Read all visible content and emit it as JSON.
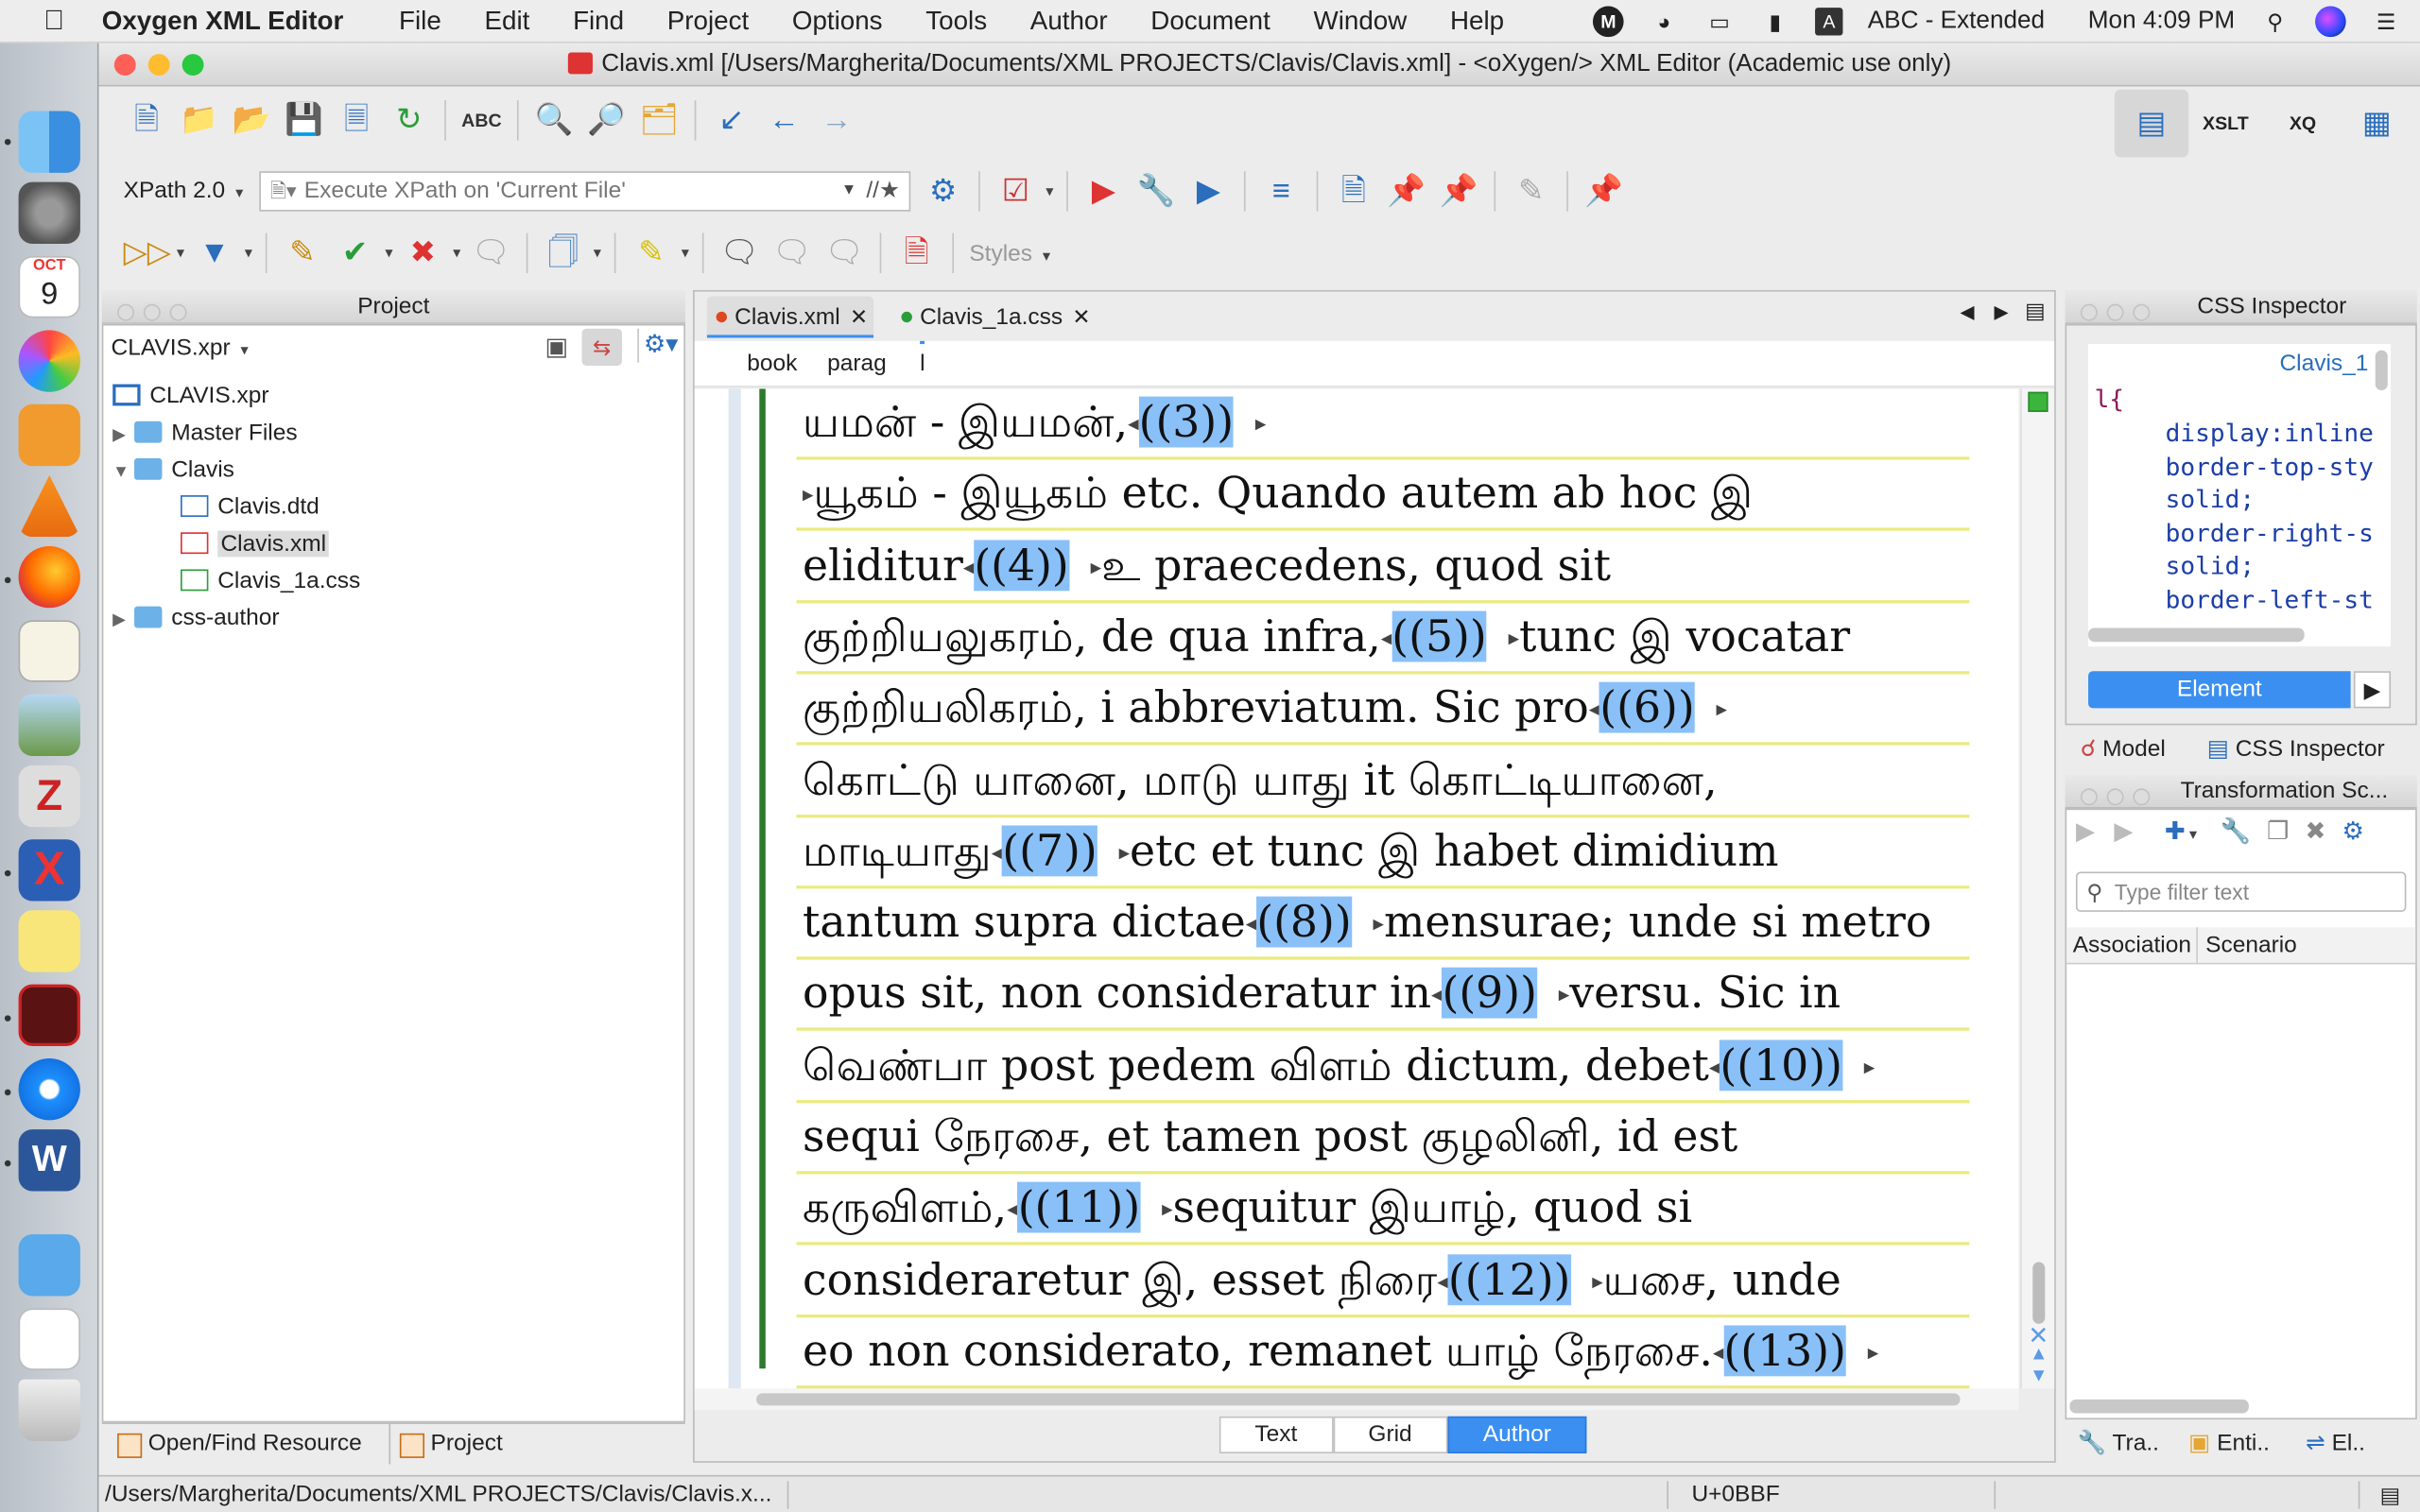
{
  "menubar": {
    "app_name": "Oxygen XML Editor",
    "menus": [
      "File",
      "Edit",
      "Find",
      "Project",
      "Options",
      "Tools",
      "Author",
      "Document",
      "Window",
      "Help"
    ],
    "input_source": "ABC - Extended",
    "clock": "Mon 4:09 PM",
    "m_letter": "M",
    "a_letter": "A"
  },
  "dock": {
    "calendar_month": "OCT",
    "calendar_day": "9"
  },
  "window": {
    "title": "Clavis.xml [/Users/Margherita/Documents/XML PROJECTS/Clavis/Clavis.xml] - <oXygen/> XML Editor (Academic use only)"
  },
  "toolbar": {
    "xpath_version": "XPath 2.0",
    "xpath_placeholder": "Execute XPath on  'Current File'",
    "styles_label": "Styles",
    "xslt_label": "XSLT",
    "xq_label": "XQ",
    "abc_label": "ABC"
  },
  "project": {
    "title": "Project",
    "selector": "CLAVIS.xpr",
    "tree": [
      {
        "label": "CLAVIS.xpr"
      },
      {
        "label": "Master Files"
      },
      {
        "label": "Clavis"
      },
      {
        "label": "Clavis.dtd"
      },
      {
        "label": "Clavis.xml"
      },
      {
        "label": "Clavis_1a.css"
      },
      {
        "label": "css-author"
      }
    ],
    "tabs": [
      "Open/Find Resource",
      "Project"
    ]
  },
  "editor": {
    "tabs": [
      "Clavis.xml",
      "Clavis_1a.css"
    ],
    "breadcrumbs": [
      "book",
      "parag",
      "l"
    ],
    "modes": [
      "Text",
      "Grid",
      "Author"
    ],
    "lines": [
      {
        "pre": "யமன் - இயமன்,",
        "note": "((3))",
        "post": ""
      },
      {
        "pre": "",
        "note": "",
        "post": "யூகம் - இயூகம் etc. Quando autem ab hoc இ"
      },
      {
        "pre": "eliditur",
        "note": "((4))",
        "post": "உ praecedens, quod sit"
      },
      {
        "pre": "குற்றியலுகரம், de qua infra,",
        "note": "((5))",
        "post": "tunc இ vocatar"
      },
      {
        "pre": "குற்றியலிகரம், i abbreviatum. Sic pro",
        "note": "((6))",
        "post": ""
      },
      {
        "pre": "கொட்டு யானை, மாடு யாது it கொட்டியானை,",
        "note": "",
        "post": ""
      },
      {
        "pre": "மாடியாது",
        "note": "((7))",
        "post": "etc et tunc இ habet dimidium"
      },
      {
        "pre": "tantum supra dictae",
        "note": "((8))",
        "post": "mensurae; unde si metro"
      },
      {
        "pre": "opus sit, non consideratur in",
        "note": "((9))",
        "post": "versu. Sic in"
      },
      {
        "pre": "வெண்பா post pedem விளம் dictum, debet",
        "note": "((10))",
        "post": ""
      },
      {
        "pre": "sequi நேரசை, et tamen post குழலினி, id est",
        "note": "",
        "post": ""
      },
      {
        "pre": "கருவிளம்,",
        "note": "((11))",
        "post": "sequitur இயாழ், quod si"
      },
      {
        "pre": "consideraretur இ, esset நிரை",
        "note": "((12))",
        "post": "யசை, unde"
      },
      {
        "pre": "eo non considerato, remanet யாழ் நேரசை.",
        "note": "((13))",
        "post": ""
      }
    ]
  },
  "css_inspector": {
    "title": "CSS Inspector",
    "file_ref": "Clavis_1",
    "code": [
      "l{",
      "display:inline",
      "border-top-sty",
      "solid;",
      "border-right-s",
      "solid;",
      "border-left-st"
    ],
    "element_button": "Element",
    "tabs": [
      "Model",
      "CSS Inspector"
    ]
  },
  "transformation": {
    "title": "Transformation Sc...",
    "filter_placeholder": "Type filter text",
    "columns": [
      "Association",
      "Scenario"
    ],
    "tabs": [
      "Tra..",
      "Enti..",
      "El.."
    ]
  },
  "status": {
    "path": "/Users/Margherita/Documents/XML PROJECTS/Clavis/Clavis.x...",
    "char": "U+0BBF"
  },
  "colors": {
    "accent": "#3b8ff0",
    "note_highlight": "#89c0f8",
    "element_border": "#eaea80",
    "change_bar": "#2c7a2c"
  }
}
